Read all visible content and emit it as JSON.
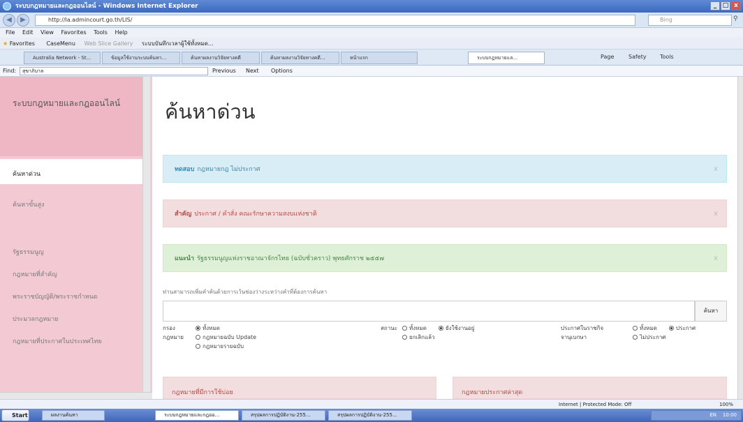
{
  "window": {
    "title": "ระบบกฎหมายและกฎออนไลน์ - Windows Internet Explorer",
    "min": "_",
    "max": "□",
    "close": "x"
  },
  "address": {
    "url": "http://la.admincourt.go.th/LIS/",
    "search_placeholder": "Bing"
  },
  "menu": [
    "File",
    "Edit",
    "View",
    "Favorites",
    "Tools",
    "Help"
  ],
  "favorites": {
    "label": "Favorites",
    "items": [
      "CaseMenu",
      "Web Slice Gallery",
      "ระบบบันทึกเวลาผู้ใช้ทั้งหมด..."
    ]
  },
  "tabs": [
    "Australia Network - St...",
    "ข้อมูลใช้งานระบบค้นหา...",
    "ค้นหาผลงานวิจัยทางคดี",
    "ค้นหาผลงานวิจัยทางคดี...",
    "หน้าแรก",
    "ระบบกฎหมายแล..."
  ],
  "toolbar_right": [
    "Page",
    "Safety",
    "Tools"
  ],
  "find": {
    "label": "Find:",
    "value": "สุขาภิบาล",
    "prev": "Previous",
    "next": "Next",
    "options": "Options"
  },
  "sidebar": {
    "title": "ระบบกฎหมายและกฎออนไลน์",
    "active_item": "ค้นหาด่วน",
    "items": [
      "ค้นหาขั้นสูง",
      "รัฐธรรมนูญ",
      "กฎหมายที่สำคัญ",
      "พระราชบัญญัติ/พระราชกำหนด",
      "ประมวลกฎหมาย",
      "กฎหมายที่ประกาศในประเทศไทย"
    ]
  },
  "main": {
    "title": "ค้นหาด่วน",
    "alert_info": {
      "strong": "ทดสอบ",
      "text": "กฎหมายกฎ ไม่ประกาศ",
      "close": "x"
    },
    "alert_danger": {
      "strong": "สำคัญ",
      "text": "ประกาศ / คำสั่ง คณะรักษาความสงบแห่งชาติ",
      "close": "x"
    },
    "alert_success": {
      "strong": "แนะนำ",
      "text": "รัฐธรรมนูญแห่งราชอาณาจักรไทย (ฉบับชั่วคราว) พุทธศักราช ๒๕๕๗",
      "close": "x"
    },
    "hint": "ท่านสามารถเพิ่มคำค้นด้วยการเว้นช่องว่างระหว่างคำที่ต้องการค้นหา",
    "search_button": "ค้นหา",
    "filters": {
      "filter_label": "กรอง กฎหมาย",
      "filter_options": [
        "ทั้งหมด",
        "กฎหมายฉบับ Update",
        "กฎหมายรายฉบับ"
      ],
      "filter_selected": 0,
      "status_label": "สถานะ",
      "status_options": [
        "ทั้งหมด",
        "ยังใช้งานอยู่",
        "ยกเลิกแล้ว"
      ],
      "status_selected": 1,
      "publish_label": "ประกาศในราชกิจจานุเบกษา",
      "publish_options": [
        "ทั้งหมด",
        "ประกาศ",
        "ไม่ประกาศ"
      ],
      "publish_selected": 1
    },
    "panel_left": "กฎหมายที่มีการใช้บ่อย",
    "panel_right": "กฎหมายประกาศล่าสุด"
  },
  "status": {
    "zone": "Internet | Protected Mode: Off",
    "zoom": "100%"
  },
  "taskbar": {
    "start": "Start",
    "items": [
      "ผลงานค้นหา",
      "ระบบกฎหมายและกฎออ...",
      "สรุปผลการปฏิบัติงาน-255...",
      "สรุปผลการปฏิบัติงาน-255..."
    ],
    "lang": "EN",
    "time": "10:00"
  }
}
